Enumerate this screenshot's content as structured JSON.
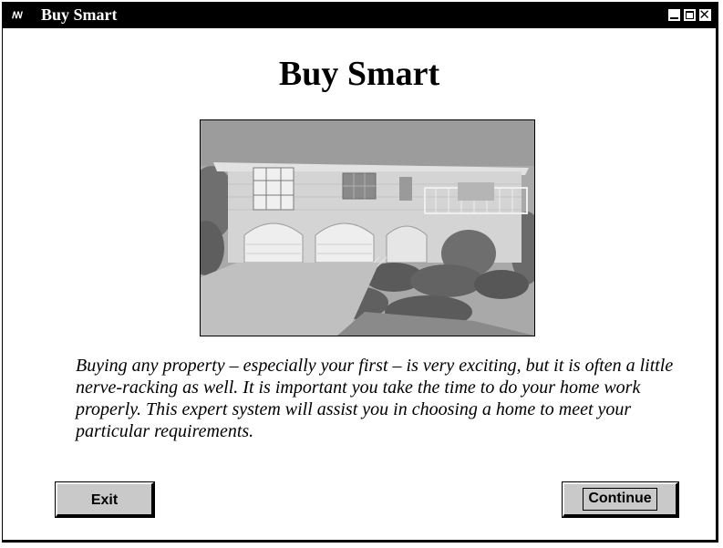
{
  "window": {
    "icon_label": "ꟿ",
    "title": "Buy Smart",
    "controls": [
      "minimize",
      "maximize",
      "close"
    ]
  },
  "main": {
    "heading": "Buy Smart",
    "intro_text": "Buying any property – especially your first – is very exciting, but it is often a little nerve-racking as well. It is important you take the time to do your home work properly. This expert system will assist you in choosing a home to meet your particular requirements."
  },
  "buttons": {
    "exit_label": "Exit",
    "continue_label": "Continue"
  },
  "icons": {
    "app": "app-icon",
    "minimize": "minimize-icon",
    "maximize": "maximize-icon",
    "close": "close-icon"
  },
  "colors": {
    "titlebar_bg": "#000000",
    "button_face": "#c9c9c9",
    "window_bg": "#ffffff"
  }
}
